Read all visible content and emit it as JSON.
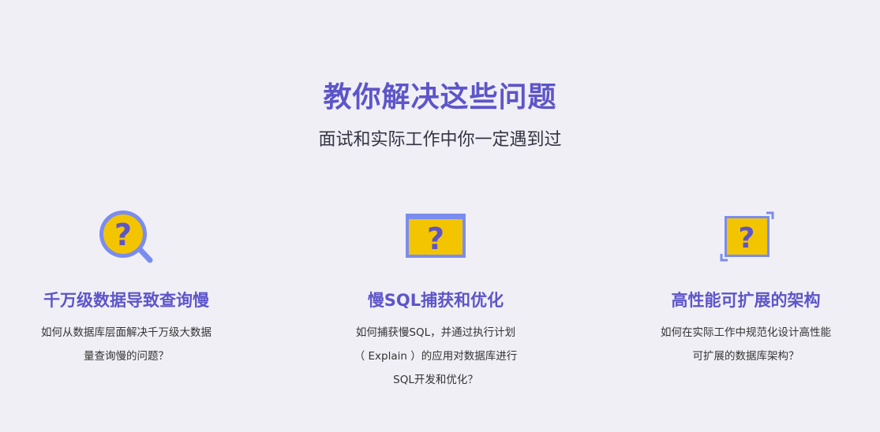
{
  "header": {
    "title": "教你解决这些问题",
    "subtitle": "面试和实际工作中你一定遇到过"
  },
  "colors": {
    "background": "#f0eff5",
    "title": "#5d55c9",
    "subtitle": "#333344",
    "body_text": "#333333",
    "icon_outline": "#7a8cf0",
    "icon_fill": "#f3c400",
    "icon_glyph": "#5d55c9"
  },
  "cards": [
    {
      "icon": "magnifier-question-icon",
      "title": "千万级数据导致查询慢",
      "desc_lines": [
        "如何从数据库层面解决千万级大数据",
        "量查询慢的问题？"
      ]
    },
    {
      "icon": "window-question-icon",
      "title": "慢SQL捕获和优化",
      "desc_lines": [
        "如何捕获慢SQL，并通过执行计划",
        "（ Explain ）的应用对数据库进行",
        "SQL开发和优化？"
      ]
    },
    {
      "icon": "expand-question-icon",
      "title": "高性能可扩展的架构",
      "desc_lines": [
        "如何在实际工作中规范化设计高性能",
        "可扩展的数据库架构？"
      ]
    }
  ]
}
